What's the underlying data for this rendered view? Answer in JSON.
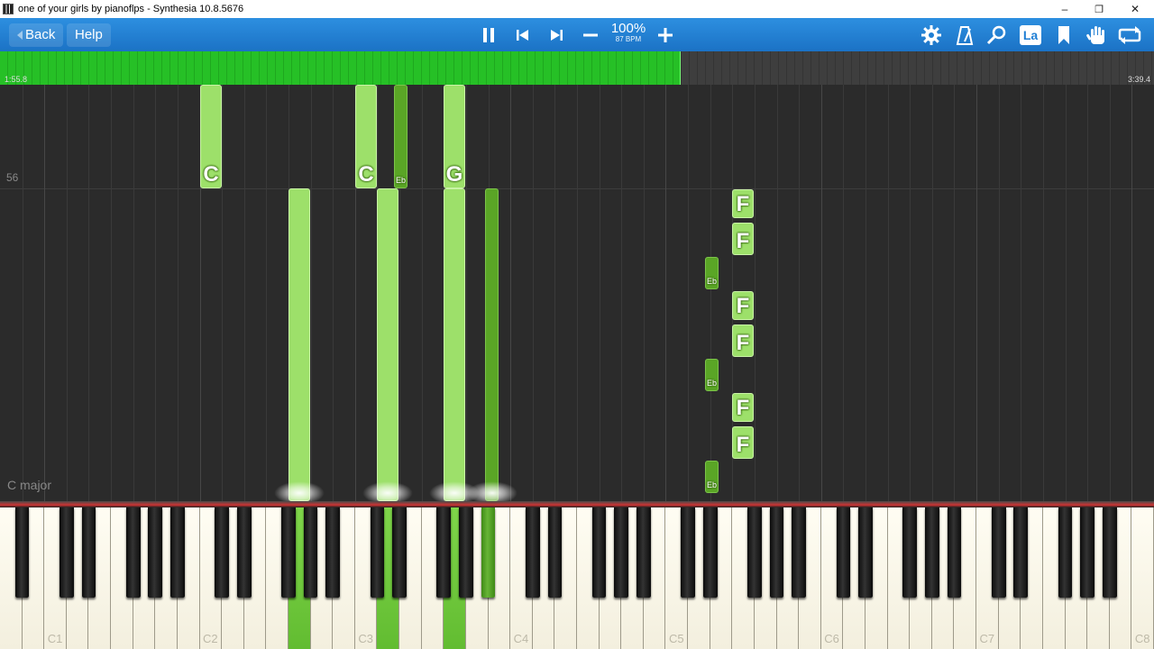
{
  "window": {
    "title": "one of your girls by pianoflps - Synthesia 10.8.5676",
    "minimize": "–",
    "restore": "❐",
    "close": "✕"
  },
  "toolbar": {
    "back_label": "Back",
    "help_label": "Help",
    "speed_percent": "100%",
    "speed_bpm": "87 BPM",
    "icons": [
      "pause-icon",
      "previous-icon",
      "next-icon",
      "minus-icon",
      "plus-icon",
      "settings-gear-icon",
      "metronome-icon",
      "magnifier-icon",
      "note-labels-icon",
      "bookmark-icon",
      "hand-icon",
      "loop-icon"
    ],
    "labels_icon_text": "La"
  },
  "progress": {
    "current_time": "1:55.8",
    "total_time": "3:39.4",
    "fraction": 0.59
  },
  "field": {
    "measure_number": "56",
    "key_signature": "C major"
  },
  "notes": [
    {
      "label": "C",
      "key": "white"
    },
    {
      "label": "C",
      "key": "white"
    },
    {
      "label": "Eb",
      "key": "black"
    },
    {
      "label": "G",
      "key": "white"
    },
    {
      "label": "",
      "key": "white"
    },
    {
      "label": "",
      "key": "white"
    },
    {
      "label": "",
      "key": "white"
    },
    {
      "label": "",
      "key": "black"
    },
    {
      "label": "F",
      "key": "white"
    },
    {
      "label": "F",
      "key": "white"
    },
    {
      "label": "Eb",
      "key": "black"
    },
    {
      "label": "F",
      "key": "white"
    },
    {
      "label": "F",
      "key": "white"
    },
    {
      "label": "Eb",
      "key": "black"
    },
    {
      "label": "F",
      "key": "white"
    },
    {
      "label": "F",
      "key": "white"
    },
    {
      "label": "Eb",
      "key": "black"
    }
  ],
  "keyboard": {
    "octave_labels": [
      "C1",
      "C2",
      "C3",
      "C4",
      "C5",
      "C6",
      "C7",
      "C8"
    ],
    "colors": {
      "hit_green": "#62bc31",
      "note_white": "#9de06a",
      "note_black": "#5aa526",
      "toolbar_blue": "#1e7ed4"
    }
  }
}
